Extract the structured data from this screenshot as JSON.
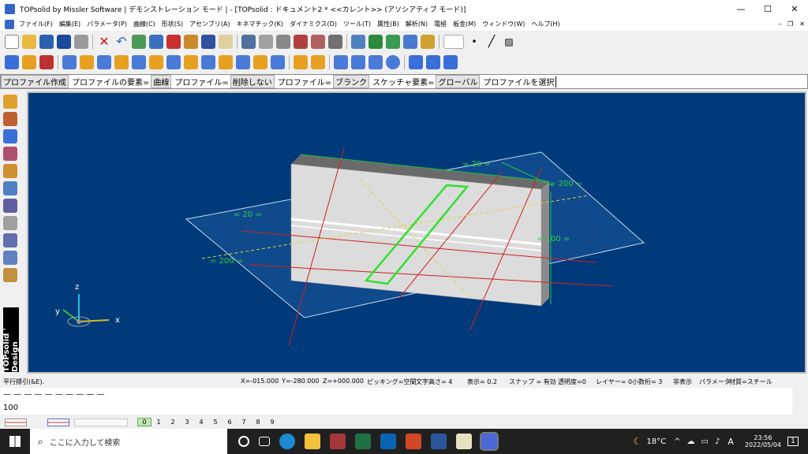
{
  "window": {
    "title": "TOPsolid by Missler Software | デモンストレーション モード | - [TOPsolid : ドキュメント2 *  <<カレント>> (アソシアティブ モード)]",
    "minimize": "—",
    "maximize": "☐",
    "close": "✕"
  },
  "menu": [
    "ファイル(F)",
    "編集(E)",
    "パラメータ(P)",
    "曲線(C)",
    "形状(S)",
    "アセンブリ(A)",
    "キネマチック(K)",
    "ダイナミクス(D)",
    "ツール(T)",
    "属性(B)",
    "解析(N)",
    "電極",
    "板金(M)",
    "ウィンドウ(W)",
    "ヘルプ(H)"
  ],
  "prompt": {
    "create": "プロファイル作成",
    "element_label": "プロファイルの要素=",
    "element_value": "曲線",
    "profile_label": "プロファイル=",
    "profile_value": "削除しない",
    "profile2_label": "プロファイル=",
    "profile2_value": "ブランク",
    "sketch_label": "スケッチャ要素=",
    "sketch_value": "グローバル",
    "select": "プロファイルを選択"
  },
  "brand": "TOPsolid ' Design",
  "dims": {
    "d20a": "= 20 =",
    "d20b": "= 20 =",
    "d200a": "= 200 =",
    "d200b": "= 200 =",
    "d100": "= 100 ="
  },
  "axes": {
    "x": "x",
    "y": "y",
    "z": "z"
  },
  "status": {
    "left": "平行掃引(&E).",
    "x": "X=-015.000",
    "y": "Y=-280.000",
    "z": "Z=+000.000",
    "picking": "ピッキング=空間",
    "text_height": "文字高さ=  4",
    "display": "表示=  0.2",
    "snap": "スナップ = 有効",
    "transparency": "透明度=0",
    "layer": "レイヤー= 0",
    "decimals": "小数桁= 3",
    "hide": "非表示",
    "params": "パラメータ",
    "material": "材質=スチール"
  },
  "cmd": {
    "line1": "— — — — — — — — — —",
    "line2": "100"
  },
  "layers": [
    "0",
    "1",
    "2",
    "3",
    "4",
    "5",
    "6",
    "7",
    "8",
    "9"
  ],
  "taskbar": {
    "search_placeholder": "ここに入力して検索",
    "weather": "18°C",
    "ime": "A",
    "time": "23:56",
    "date": "2022/05/04",
    "notif": "1"
  }
}
